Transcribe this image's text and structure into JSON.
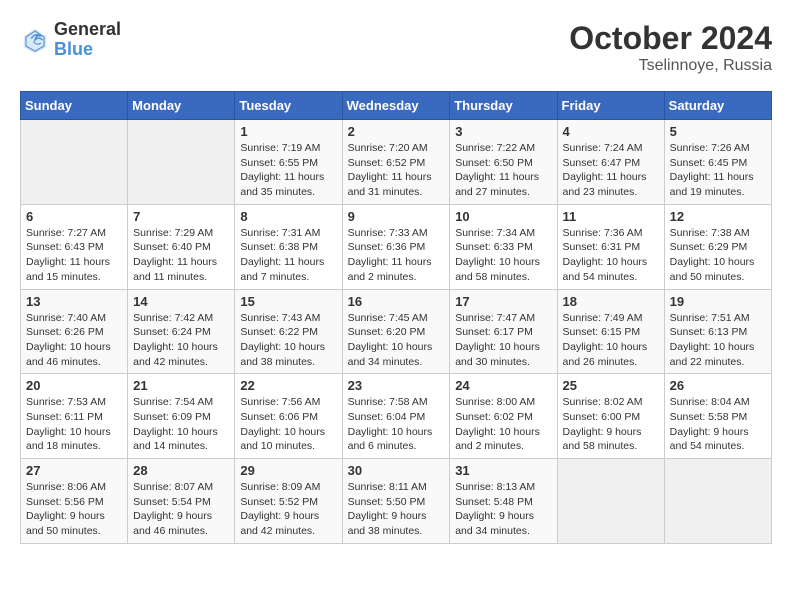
{
  "header": {
    "logo_line1": "General",
    "logo_line2": "Blue",
    "title": "October 2024",
    "subtitle": "Tselinnoye, Russia"
  },
  "days_of_week": [
    "Sunday",
    "Monday",
    "Tuesday",
    "Wednesday",
    "Thursday",
    "Friday",
    "Saturday"
  ],
  "weeks": [
    [
      {
        "day": "",
        "detail": ""
      },
      {
        "day": "",
        "detail": ""
      },
      {
        "day": "1",
        "detail": "Sunrise: 7:19 AM\nSunset: 6:55 PM\nDaylight: 11 hours and 35 minutes."
      },
      {
        "day": "2",
        "detail": "Sunrise: 7:20 AM\nSunset: 6:52 PM\nDaylight: 11 hours and 31 minutes."
      },
      {
        "day": "3",
        "detail": "Sunrise: 7:22 AM\nSunset: 6:50 PM\nDaylight: 11 hours and 27 minutes."
      },
      {
        "day": "4",
        "detail": "Sunrise: 7:24 AM\nSunset: 6:47 PM\nDaylight: 11 hours and 23 minutes."
      },
      {
        "day": "5",
        "detail": "Sunrise: 7:26 AM\nSunset: 6:45 PM\nDaylight: 11 hours and 19 minutes."
      }
    ],
    [
      {
        "day": "6",
        "detail": "Sunrise: 7:27 AM\nSunset: 6:43 PM\nDaylight: 11 hours and 15 minutes."
      },
      {
        "day": "7",
        "detail": "Sunrise: 7:29 AM\nSunset: 6:40 PM\nDaylight: 11 hours and 11 minutes."
      },
      {
        "day": "8",
        "detail": "Sunrise: 7:31 AM\nSunset: 6:38 PM\nDaylight: 11 hours and 7 minutes."
      },
      {
        "day": "9",
        "detail": "Sunrise: 7:33 AM\nSunset: 6:36 PM\nDaylight: 11 hours and 2 minutes."
      },
      {
        "day": "10",
        "detail": "Sunrise: 7:34 AM\nSunset: 6:33 PM\nDaylight: 10 hours and 58 minutes."
      },
      {
        "day": "11",
        "detail": "Sunrise: 7:36 AM\nSunset: 6:31 PM\nDaylight: 10 hours and 54 minutes."
      },
      {
        "day": "12",
        "detail": "Sunrise: 7:38 AM\nSunset: 6:29 PM\nDaylight: 10 hours and 50 minutes."
      }
    ],
    [
      {
        "day": "13",
        "detail": "Sunrise: 7:40 AM\nSunset: 6:26 PM\nDaylight: 10 hours and 46 minutes."
      },
      {
        "day": "14",
        "detail": "Sunrise: 7:42 AM\nSunset: 6:24 PM\nDaylight: 10 hours and 42 minutes."
      },
      {
        "day": "15",
        "detail": "Sunrise: 7:43 AM\nSunset: 6:22 PM\nDaylight: 10 hours and 38 minutes."
      },
      {
        "day": "16",
        "detail": "Sunrise: 7:45 AM\nSunset: 6:20 PM\nDaylight: 10 hours and 34 minutes."
      },
      {
        "day": "17",
        "detail": "Sunrise: 7:47 AM\nSunset: 6:17 PM\nDaylight: 10 hours and 30 minutes."
      },
      {
        "day": "18",
        "detail": "Sunrise: 7:49 AM\nSunset: 6:15 PM\nDaylight: 10 hours and 26 minutes."
      },
      {
        "day": "19",
        "detail": "Sunrise: 7:51 AM\nSunset: 6:13 PM\nDaylight: 10 hours and 22 minutes."
      }
    ],
    [
      {
        "day": "20",
        "detail": "Sunrise: 7:53 AM\nSunset: 6:11 PM\nDaylight: 10 hours and 18 minutes."
      },
      {
        "day": "21",
        "detail": "Sunrise: 7:54 AM\nSunset: 6:09 PM\nDaylight: 10 hours and 14 minutes."
      },
      {
        "day": "22",
        "detail": "Sunrise: 7:56 AM\nSunset: 6:06 PM\nDaylight: 10 hours and 10 minutes."
      },
      {
        "day": "23",
        "detail": "Sunrise: 7:58 AM\nSunset: 6:04 PM\nDaylight: 10 hours and 6 minutes."
      },
      {
        "day": "24",
        "detail": "Sunrise: 8:00 AM\nSunset: 6:02 PM\nDaylight: 10 hours and 2 minutes."
      },
      {
        "day": "25",
        "detail": "Sunrise: 8:02 AM\nSunset: 6:00 PM\nDaylight: 9 hours and 58 minutes."
      },
      {
        "day": "26",
        "detail": "Sunrise: 8:04 AM\nSunset: 5:58 PM\nDaylight: 9 hours and 54 minutes."
      }
    ],
    [
      {
        "day": "27",
        "detail": "Sunrise: 8:06 AM\nSunset: 5:56 PM\nDaylight: 9 hours and 50 minutes."
      },
      {
        "day": "28",
        "detail": "Sunrise: 8:07 AM\nSunset: 5:54 PM\nDaylight: 9 hours and 46 minutes."
      },
      {
        "day": "29",
        "detail": "Sunrise: 8:09 AM\nSunset: 5:52 PM\nDaylight: 9 hours and 42 minutes."
      },
      {
        "day": "30",
        "detail": "Sunrise: 8:11 AM\nSunset: 5:50 PM\nDaylight: 9 hours and 38 minutes."
      },
      {
        "day": "31",
        "detail": "Sunrise: 8:13 AM\nSunset: 5:48 PM\nDaylight: 9 hours and 34 minutes."
      },
      {
        "day": "",
        "detail": ""
      },
      {
        "day": "",
        "detail": ""
      }
    ]
  ]
}
